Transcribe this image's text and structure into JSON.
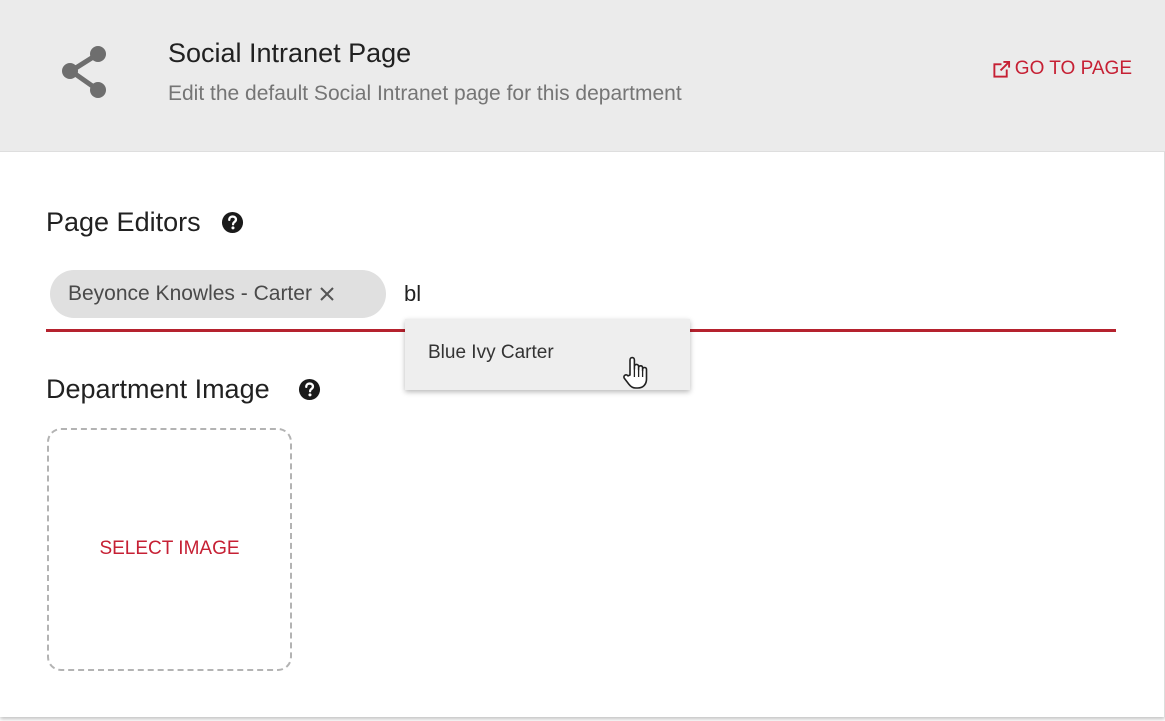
{
  "header": {
    "title": "Social Intranet Page",
    "subtitle": "Edit the default Social Intranet page for this department",
    "go_to_page_label": "GO TO PAGE",
    "icon": "share-icon"
  },
  "page_editors": {
    "title": "Page Editors",
    "help_icon": "help-circle-icon",
    "chips": [
      {
        "label": "Beyonce Knowles - Carter"
      }
    ],
    "input_value": "bl",
    "suggestions": [
      {
        "label": "Blue Ivy Carter"
      }
    ]
  },
  "department_image": {
    "title": "Department Image",
    "help_icon": "help-circle-icon",
    "select_label": "SELECT IMAGE"
  },
  "colors": {
    "accent": "#c62034",
    "underline": "#b5222e",
    "header_bg": "#ebebeb",
    "chip_bg": "#e0e0e0"
  }
}
